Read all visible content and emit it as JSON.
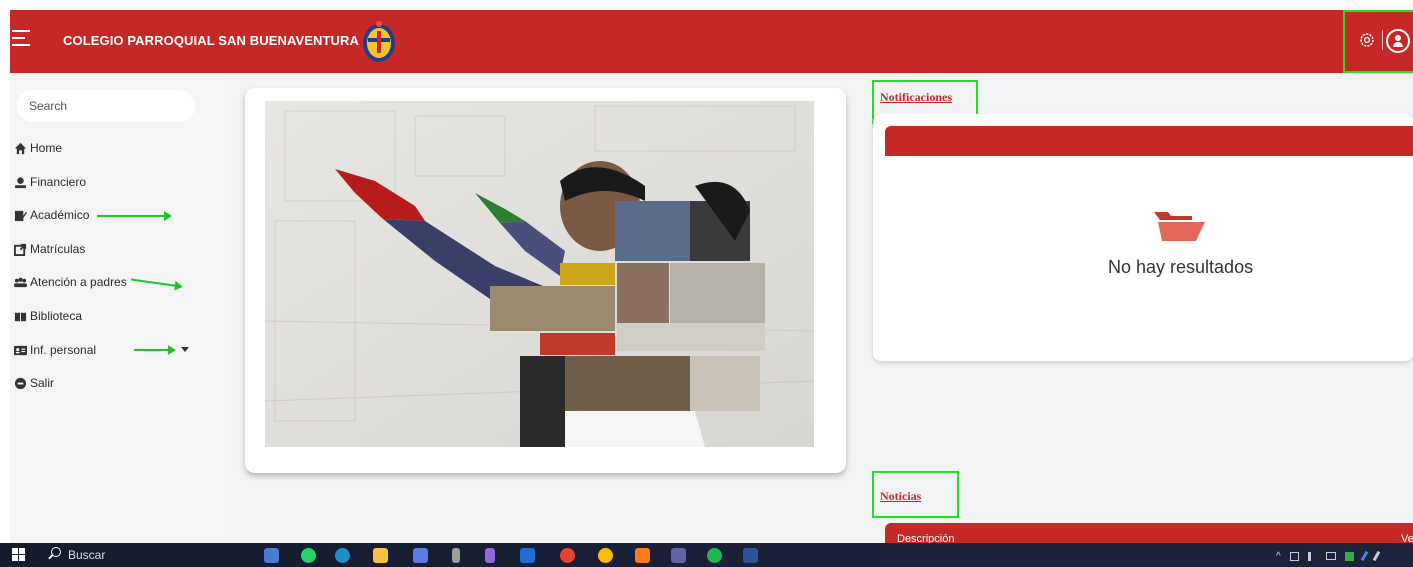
{
  "header": {
    "school_name": "COLEGIO PARROQUIAL SAN BUENAVENTURA",
    "brand_color": "#c62828"
  },
  "sidebar": {
    "search_placeholder": "Search",
    "items": [
      {
        "label": "Home",
        "icon": "home-icon"
      },
      {
        "label": "Financiero",
        "icon": "user-circle-icon"
      },
      {
        "label": "Académico",
        "icon": "edit-icon"
      },
      {
        "label": "Matrículas",
        "icon": "external-link-icon"
      },
      {
        "label": "Atención a padres",
        "icon": "users-icon"
      },
      {
        "label": "Biblioteca",
        "icon": "book-icon"
      },
      {
        "label": "Inf. personal",
        "icon": "id-card-icon"
      },
      {
        "label": "Salir",
        "icon": "power-icon"
      }
    ]
  },
  "notifications": {
    "title": "Notificaciones",
    "empty_text": "No hay resultados"
  },
  "news": {
    "title": "Noticias",
    "col_description": "Descripción",
    "col_view": "Ve"
  },
  "taskbar": {
    "search_label": "Buscar"
  },
  "annotation_color": "#22e022"
}
